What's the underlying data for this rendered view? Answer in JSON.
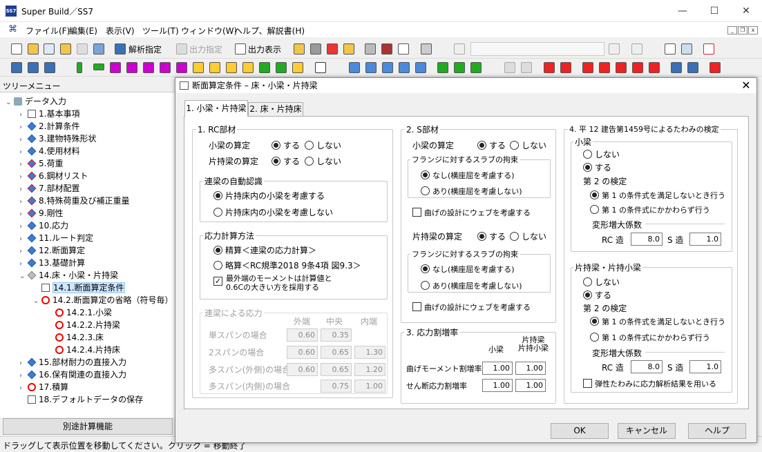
{
  "window": {
    "title": "Super Build／SS7",
    "minimize": "—",
    "maximize": "☐",
    "close": "✕"
  },
  "menu": [
    "ファイル(F)",
    "編集(E)",
    "表示(V)",
    "ツール(T)",
    "ウィンドウ(W)",
    "ヘルプ、解説書(H)"
  ],
  "toolbar": {
    "analysis_label": "解析指定",
    "output_spec_label": "出力指定",
    "output_view_label": "出力表示"
  },
  "tree": {
    "title": "ツリーメニュー",
    "items": [
      {
        "label": "データ入力"
      },
      {
        "label": "1.基本事項"
      },
      {
        "label": "2.計算条件"
      },
      {
        "label": "3.建物特殊形状"
      },
      {
        "label": "4.使用材料"
      },
      {
        "label": "5.荷重"
      },
      {
        "label": "6.鋼材リスト"
      },
      {
        "label": "7.部材配置"
      },
      {
        "label": "8.特殊荷重及び補正重量"
      },
      {
        "label": "9.剛性"
      },
      {
        "label": "10.応力"
      },
      {
        "label": "11.ルート判定"
      },
      {
        "label": "12.断面算定"
      },
      {
        "label": "13.基礎計算"
      },
      {
        "label": "14.床・小梁・片持梁"
      },
      {
        "label": "14.1.断面算定条件"
      },
      {
        "label": "14.2.断面算定の省略（符号毎）"
      },
      {
        "label": "14.2.1.小梁"
      },
      {
        "label": "14.2.2.片持梁"
      },
      {
        "label": "14.2.3.床"
      },
      {
        "label": "14.2.4.片持床"
      },
      {
        "label": "15.部材耐力の直接入力"
      },
      {
        "label": "16.保有関連の直接入力"
      },
      {
        "label": "17.積算"
      },
      {
        "label": "18.デフォルトデータの保存"
      }
    ],
    "bottom_button": "別途計算機能"
  },
  "status": "ドラッグして表示位置を移動してください。クリック = 移動終了",
  "dialog": {
    "title": "断面算定条件 – 床・小梁・片持梁",
    "tabs": [
      "1. 小梁・片持梁",
      "2. 床・片持床"
    ],
    "rc": {
      "title": "1. RC部材",
      "small_beam": "小梁の算定",
      "cantilever": "片持梁の算定",
      "yes": "する",
      "no": "しない",
      "auto_title": "連梁の自動認識",
      "auto_opt1": "片持床内の小梁を考慮する",
      "auto_opt2": "片持床内の小梁を考慮しない",
      "stress_title": "応力計算方法",
      "stress_opt1": "精算＜連梁の応力計算＞",
      "stress_opt2": "略算＜RC規準2018 9条4項 図9.3＞",
      "outer_moment": "最外端のモーメントは計算値と",
      "outer_moment2": "0.6Cの大きい方を採用する",
      "cont_title": "連梁による応力",
      "col_outer": "外端",
      "col_center": "中央",
      "col_inner": "内端",
      "rows": [
        {
          "label": "単スパンの場合",
          "outer": "0.60",
          "center": "0.35",
          "inner": ""
        },
        {
          "label": "2スパンの場合",
          "outer": "0.60",
          "center": "0.65",
          "inner": "1.30"
        },
        {
          "label": "多スパン(外側)の場合",
          "outer": "0.60",
          "center": "0.65",
          "inner": "1.20"
        },
        {
          "label": "多スパン(内側)の場合",
          "outer": "",
          "center": "0.75",
          "inner": "1.00"
        }
      ]
    },
    "s": {
      "title": "2. S部材",
      "small_beam": "小梁の算定",
      "cantilever": "片持梁の算定",
      "yes": "する",
      "no": "しない",
      "flange_title": "フランジに対するスラブの拘束",
      "flange_opt1": "なし(横座屈を考慮する)",
      "flange_opt2": "あり(横座屈を考慮しない)",
      "web": "曲げの設計にウェブを考慮する"
    },
    "ratio": {
      "title": "3. 応力割増率",
      "col1": "小梁",
      "col2a": "片持梁",
      "col2b": "片持小梁",
      "bending": "曲げモーメント割増率",
      "shear": "せん断応力割増率",
      "bending_v1": "1.00",
      "bending_v2": "1.00",
      "shear_v1": "1.00",
      "shear_v2": "1.00"
    },
    "deflect": {
      "title": "4. 平 12 建告第1459号によるたわみの検定",
      "small_title": "小梁",
      "cant_title": "片持梁・片持小梁",
      "no": "しない",
      "yes": "する",
      "second": "第 2 の検定",
      "opt1": "第 1 の条件式を満足しないとき行う",
      "opt2": "第 1 の条件式にかかわらず行う",
      "factor": "変形増大係数",
      "rc": "RC 造",
      "s": "S 造",
      "small_rc": "8.0",
      "small_s": "1.0",
      "cant_rc": "8.0",
      "cant_s": "1.0",
      "elastic": "弾性たわみに応力解析結果を用いる"
    },
    "ok": "OK",
    "cancel": "キャンセル",
    "help": "ヘルプ"
  }
}
